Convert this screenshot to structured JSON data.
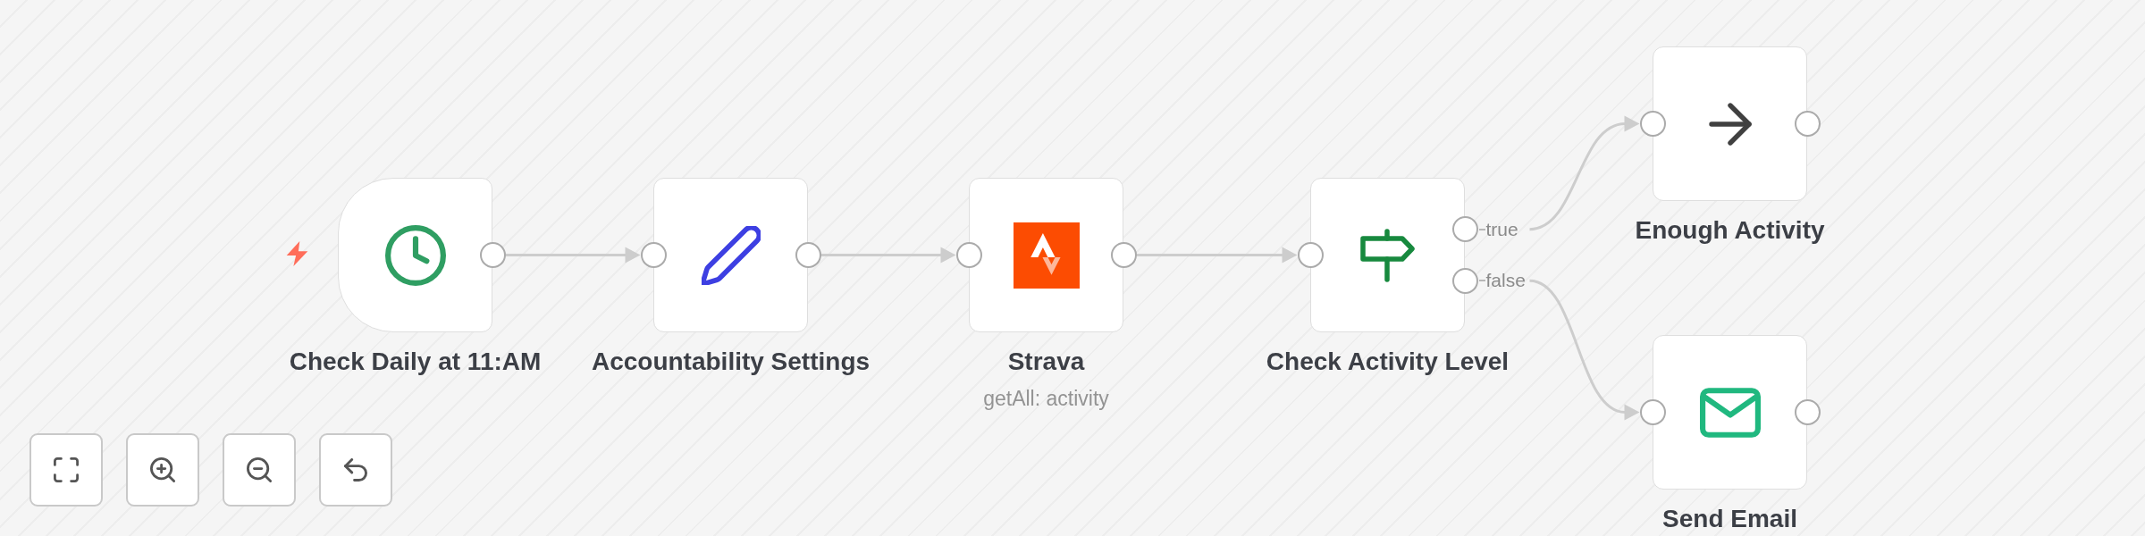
{
  "canvas": {
    "nodes": [
      {
        "kind": "schedule",
        "title": "Check Daily at 11:AM",
        "trigger": true
      },
      {
        "kind": "edit",
        "title": "Accountability Settings",
        "trigger": false
      },
      {
        "kind": "strava",
        "title": "Strava",
        "subtitle": "getAll: activity",
        "trigger": false
      },
      {
        "kind": "if",
        "title": "Check Activity Level",
        "trigger": false,
        "outputs": [
          {
            "label": "true"
          },
          {
            "label": "false"
          }
        ]
      },
      {
        "kind": "noop",
        "title": "Enough Activity",
        "trigger": false
      },
      {
        "kind": "email",
        "title": "Send Email",
        "trigger": false
      }
    ]
  },
  "zoom_controls": [
    {
      "kind": "fit"
    },
    {
      "kind": "zoomin"
    },
    {
      "kind": "zoomout"
    },
    {
      "kind": "reset"
    }
  ]
}
